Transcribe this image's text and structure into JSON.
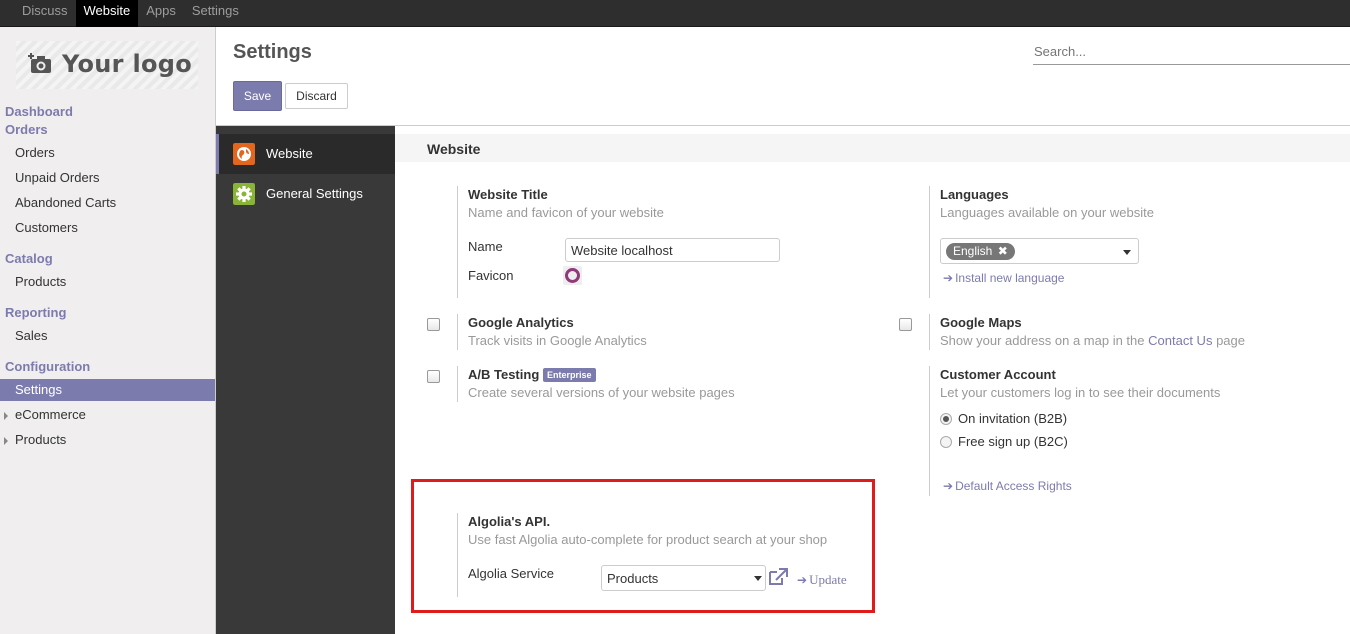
{
  "topbar": {
    "items": [
      "Discuss",
      "Website",
      "Apps",
      "Settings"
    ],
    "active": "Website"
  },
  "sidebar": {
    "logo_text": "Your logo",
    "dashboard": "Dashboard",
    "orders_head": "Orders",
    "orders_items": [
      "Orders",
      "Unpaid Orders",
      "Abandoned Carts",
      "Customers"
    ],
    "catalog_head": "Catalog",
    "catalog_items": [
      "Products"
    ],
    "reporting_head": "Reporting",
    "reporting_items": [
      "Sales"
    ],
    "configuration_head": "Configuration",
    "configuration_items": [
      "Settings"
    ],
    "tree_items": [
      "eCommerce",
      "Products"
    ]
  },
  "control_panel": {
    "title": "Settings",
    "save_label": "Save",
    "discard_label": "Discard",
    "search_placeholder": "Search..."
  },
  "app_nav": {
    "tabs": [
      {
        "label": "Website",
        "icon": "globe-icon",
        "color": "#e2661e"
      },
      {
        "label": "General Settings",
        "icon": "gear-icon",
        "color": "#8ab435"
      }
    ]
  },
  "section": {
    "title": "Website",
    "website_title": {
      "title": "Website Title",
      "desc": "Name and favicon of your website",
      "name_label": "Name",
      "name_value": "Website localhost",
      "favicon_label": "Favicon"
    },
    "languages": {
      "title": "Languages",
      "desc": "Languages available on your website",
      "tag": "English",
      "install_link": "Install new language"
    },
    "google_analytics": {
      "title": "Google Analytics",
      "desc": "Track visits in Google Analytics"
    },
    "google_maps": {
      "title": "Google Maps",
      "desc_pre": "Show your address on a map in the",
      "desc_link": "Contact Us",
      "desc_post": "page"
    },
    "ab_testing": {
      "title": "A/B Testing",
      "badge": "Enterprise",
      "desc": "Create several versions of your website pages"
    },
    "customer_account": {
      "title": "Customer Account",
      "desc": "Let your customers log in to see their documents",
      "options": [
        "On invitation (B2B)",
        "Free sign up (B2C)"
      ],
      "selected": "On invitation (B2B)",
      "access_link": "Default Access Rights"
    },
    "algolia": {
      "title": "Algolia's API.",
      "desc": "Use fast Algolia auto-complete for product search at your shop",
      "service_label": "Algolia Service",
      "service_value": "Products",
      "update_link": "Update"
    }
  },
  "colors": {
    "accent": "#7c7bad",
    "navbar": "#2e2e2e",
    "highlight": "#e01b1b"
  }
}
